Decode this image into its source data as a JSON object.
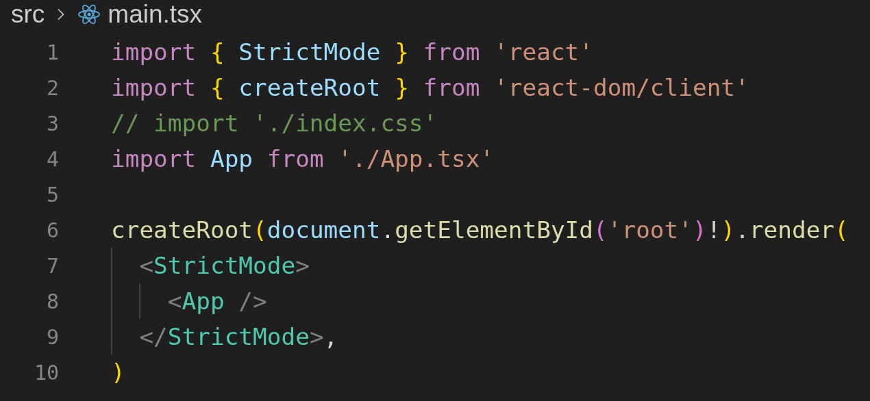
{
  "breadcrumb": [
    {
      "label": "src",
      "kind": "folder"
    },
    {
      "label": "main.tsx",
      "kind": "file"
    }
  ],
  "lines": [
    {
      "number": "1",
      "tokens": [
        {
          "text": "import ",
          "kind": "keyword"
        },
        {
          "text": "{",
          "kind": "brace"
        },
        {
          "text": " StrictMode ",
          "kind": "variable"
        },
        {
          "text": "}",
          "kind": "brace"
        },
        {
          "text": " from ",
          "kind": "keyword"
        },
        {
          "text": "'react'",
          "kind": "string"
        }
      ]
    },
    {
      "number": "2",
      "tokens": [
        {
          "text": "import ",
          "kind": "keyword"
        },
        {
          "text": "{",
          "kind": "brace"
        },
        {
          "text": " createRoot ",
          "kind": "variable"
        },
        {
          "text": "}",
          "kind": "brace"
        },
        {
          "text": " from ",
          "kind": "keyword"
        },
        {
          "text": "'react-dom/client'",
          "kind": "string"
        }
      ]
    },
    {
      "number": "3",
      "tokens": [
        {
          "text": "// import './index.css'",
          "kind": "comment"
        }
      ]
    },
    {
      "number": "4",
      "tokens": [
        {
          "text": "import",
          "kind": "keyword"
        },
        {
          "text": " App ",
          "kind": "variable"
        },
        {
          "text": "from ",
          "kind": "keyword"
        },
        {
          "text": "'./App.tsx'",
          "kind": "string"
        }
      ]
    },
    {
      "number": "5"
    },
    {
      "number": "6",
      "tokens": [
        {
          "text": "createRoot",
          "kind": "function"
        },
        {
          "text": "(",
          "kind": "brace"
        },
        {
          "text": "document",
          "kind": "variable"
        },
        {
          "text": ".",
          "kind": "plain"
        },
        {
          "text": "getElementById",
          "kind": "function"
        },
        {
          "text": "(",
          "kind": "brace2"
        },
        {
          "text": "'root'",
          "kind": "string"
        },
        {
          "text": ")",
          "kind": "brace2"
        },
        {
          "text": "!",
          "kind": "plain"
        },
        {
          "text": ")",
          "kind": "brace"
        },
        {
          "text": ".",
          "kind": "plain"
        },
        {
          "text": "render",
          "kind": "function"
        },
        {
          "text": "(",
          "kind": "brace"
        }
      ],
      "children": [
        {
          "number": "7",
          "tokens": [
            {
              "text": "<",
              "kind": "tag-bracket"
            },
            {
              "text": "StrictMode",
              "kind": "tag"
            },
            {
              "text": ">",
              "kind": "tag-bracket"
            }
          ],
          "children": [
            {
              "number": "8",
              "tokens": [
                {
                  "text": "<",
                  "kind": "tag-bracket"
                },
                {
                  "text": "App",
                  "kind": "tag"
                },
                {
                  "text": " />",
                  "kind": "tag-bracket"
                }
              ]
            }
          ]
        },
        {
          "number": "9",
          "tokens": [
            {
              "text": "</",
              "kind": "tag-bracket"
            },
            {
              "text": "StrictMode",
              "kind": "tag"
            },
            {
              "text": ">",
              "kind": "tag-bracket"
            },
            {
              "text": ",",
              "kind": "plain"
            }
          ]
        }
      ]
    },
    {
      "number": "10",
      "tokens": [
        {
          "text": ")",
          "kind": "brace"
        }
      ]
    }
  ]
}
